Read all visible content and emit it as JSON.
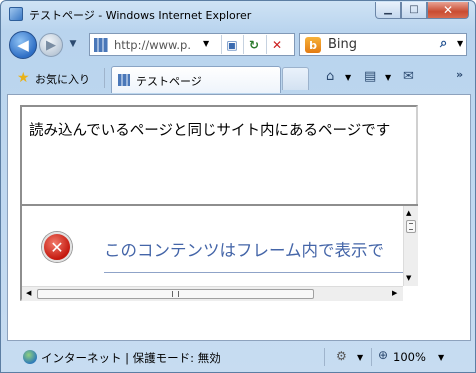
{
  "window": {
    "title": "テストページ - Windows Internet Explorer"
  },
  "caption": {
    "minimize": "▁",
    "maximize": "□",
    "close": "✕"
  },
  "navbar": {
    "back_glyph": "◀",
    "forward_glyph": "▶",
    "dropdown_glyph": "▼",
    "address_text": "http://www.p.",
    "compat_glyph": "▣",
    "refresh_glyph": "↻",
    "stop_glyph": "✕",
    "search_text": "Bing",
    "search_glyph": "⌕"
  },
  "tabbar": {
    "favorites_label": "お気に入り",
    "active_tab_label": "テストページ",
    "home_glyph": "⌂",
    "feeds_glyph": "▤",
    "mail_glyph": "✉",
    "more_glyph": "»"
  },
  "page": {
    "frame_text": "読み込んでいるページと同じサイト内にあるページです",
    "error_text": "このコンテンツはフレーム内で表示で",
    "error_glyph": "✕",
    "hscroll_grip": "III"
  },
  "statusbar": {
    "zone_text": "インターネット | 保護モード: 無効",
    "zoom_text": "100%"
  },
  "colors": {
    "error_text": "#4465a8",
    "window_frame": "#b9d4ee"
  }
}
